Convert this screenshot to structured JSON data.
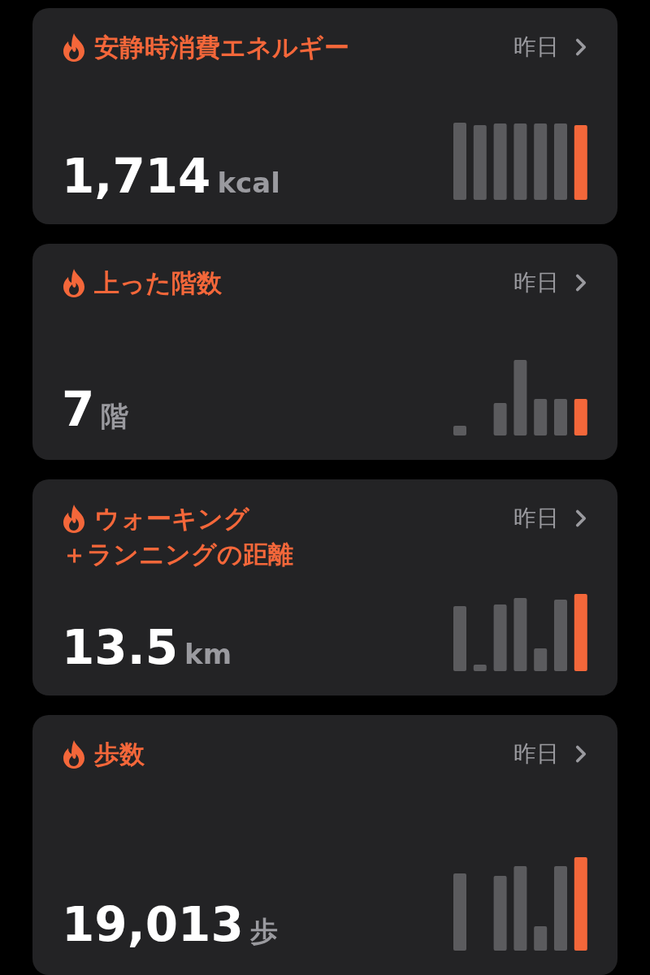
{
  "cards": [
    {
      "title": [
        "安静時消費エネルギー"
      ],
      "period": "昨日",
      "value": "1,714",
      "unit": "kcal"
    },
    {
      "title": [
        "上った階数"
      ],
      "period": "昨日",
      "value": "7",
      "unit": "階"
    },
    {
      "title": [
        "ウォーキング",
        "＋ランニングの距離"
      ],
      "period": "昨日",
      "value": "13.5",
      "unit": "km"
    },
    {
      "title": [
        "歩数"
      ],
      "period": "昨日",
      "value": "19,013",
      "unit": "歩"
    }
  ]
}
